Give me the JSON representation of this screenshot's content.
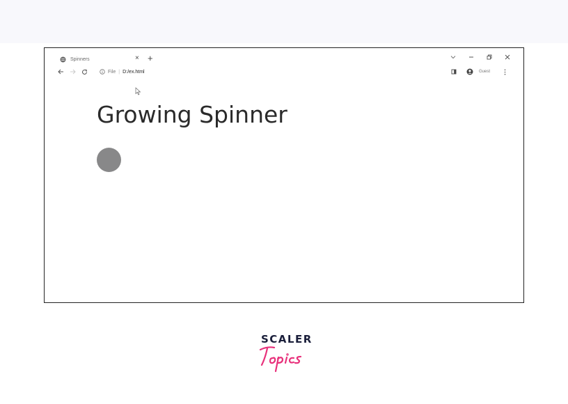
{
  "browser": {
    "tab": {
      "title": "Spinners",
      "favicon": "globe-icon",
      "close_glyph": "×",
      "new_tab_glyph": "+"
    },
    "window_controls": [
      "chevron-down-icon",
      "minimize-icon",
      "restore-icon",
      "close-icon"
    ],
    "toolbar": {
      "back_icon": "back-arrow-icon",
      "forward_icon": "forward-arrow-icon",
      "reload_icon": "reload-icon",
      "site_info_icon": "info-icon",
      "scheme_label": "File",
      "separator": "|",
      "url": "D:/ex.html",
      "side_panel_icon": "side-panel-icon",
      "profile_icon": "profile-icon",
      "profile_label": "Guest",
      "menu_icon": "kebab-menu-icon"
    }
  },
  "page": {
    "heading": "Growing Spinner",
    "spinner_color": "#888889"
  },
  "logo": {
    "word": "SCALER",
    "script": "Topics",
    "word_color": "#1b1f3b",
    "script_color": "#e8317b"
  }
}
